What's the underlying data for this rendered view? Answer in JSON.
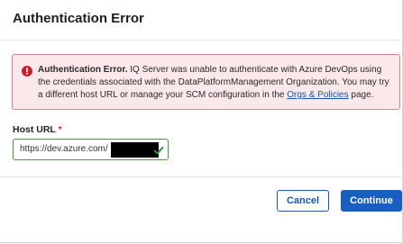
{
  "dialog": {
    "title": "Authentication Error"
  },
  "alert": {
    "icon": "error-icon",
    "color": "#d62d3a",
    "heading": "Authentication Error.",
    "message_part1": " IQ Server was unable to authenticate with Azure DevOps using the credentials associated with the DataPlatformManagement Organization. You may try a different host URL or manage your SCM configuration in the ",
    "link_label": "Orgs & Policies",
    "message_part2": " page."
  },
  "host_url": {
    "label": "Host URL",
    "required_marker": "*",
    "value": "https://dev.azure.com/",
    "valid_icon": "check-icon",
    "valid_color": "#3d8b3d"
  },
  "actions": {
    "cancel_label": "Cancel",
    "continue_label": "Continue",
    "primary_color": "#1a5fbf"
  }
}
